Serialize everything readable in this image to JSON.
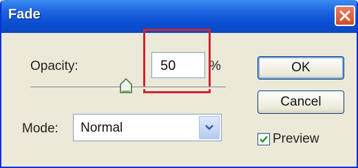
{
  "window": {
    "title": "Fade",
    "close_icon": "close-x-icon"
  },
  "opacity": {
    "label": "Opacity:",
    "value": "50",
    "unit": "%",
    "slider_percent": 50
  },
  "buttons": {
    "ok_label": "OK",
    "cancel_label": "Cancel"
  },
  "mode": {
    "label": "Mode:",
    "selected": "Normal"
  },
  "preview": {
    "label": "Preview",
    "checked": true
  },
  "colors": {
    "titlebar": "#0a4fd1",
    "close_button": "#d04a2a",
    "highlight_box": "#d0222e",
    "dialog_background": "#ece9d8"
  }
}
